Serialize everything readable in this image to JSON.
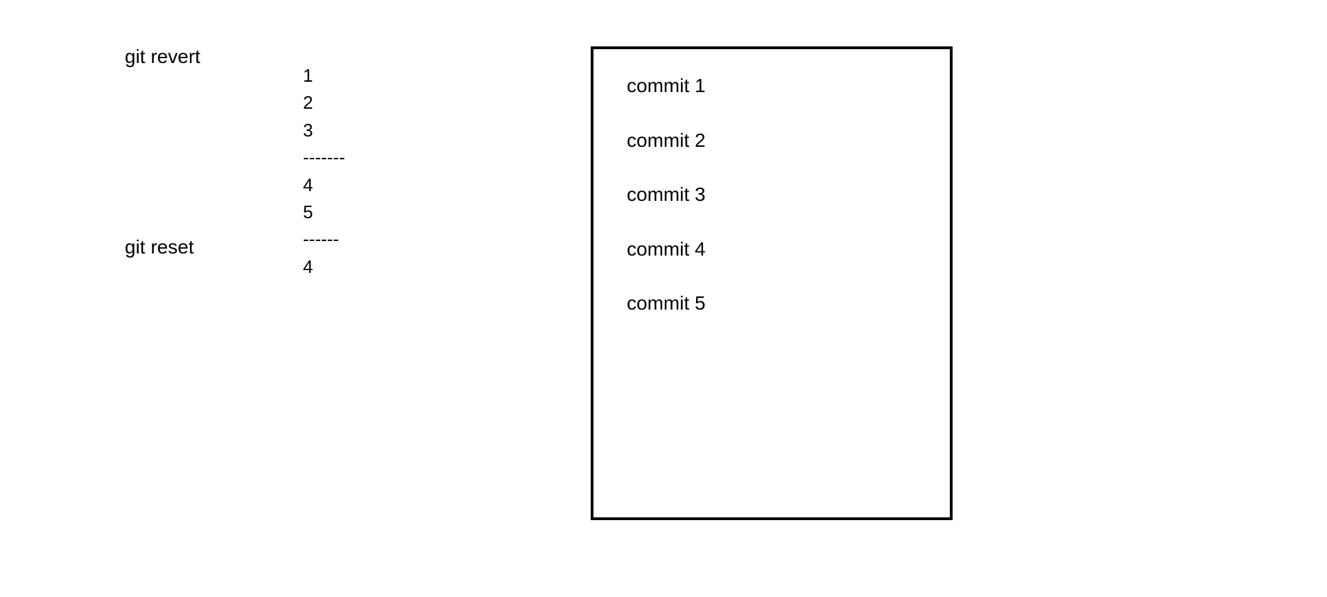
{
  "labels": {
    "revert": "git revert",
    "reset": "git reset"
  },
  "stack": [
    "1",
    "2",
    "3",
    "-------",
    "4",
    "5",
    "------",
    "4"
  ],
  "commits": [
    "commit 1",
    "commit 2",
    "commit 3",
    "commit 4",
    "commit 5"
  ]
}
